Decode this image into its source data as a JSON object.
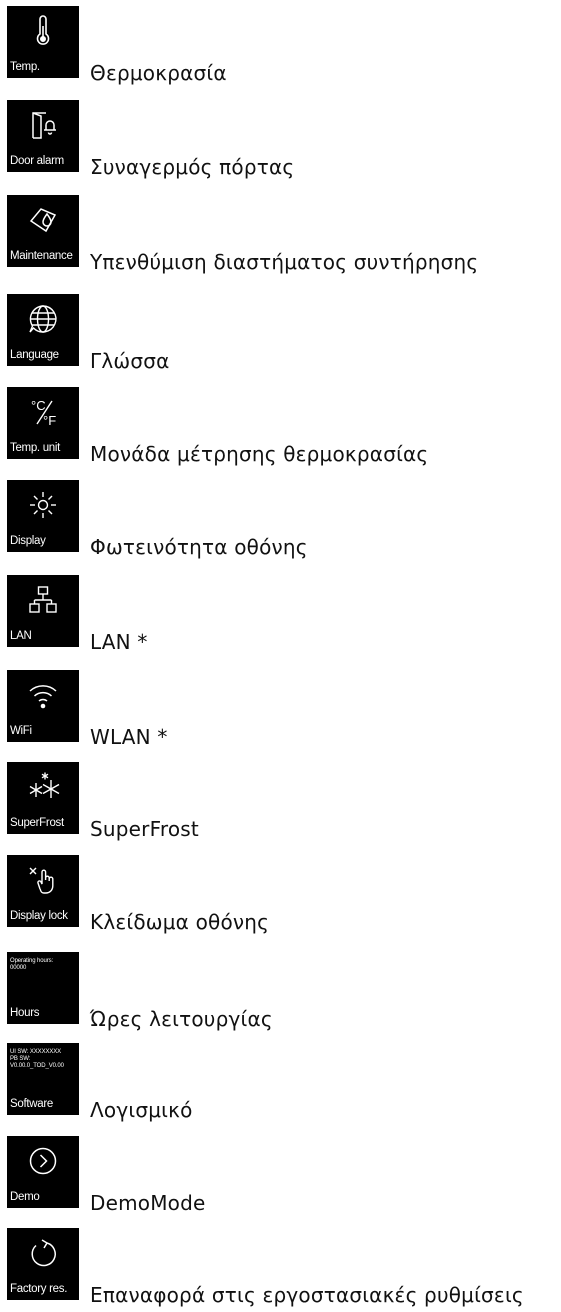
{
  "menu": {
    "items": [
      {
        "caption": "Temp.",
        "label": "Θερμοκρασία",
        "icon": "thermometer-icon"
      },
      {
        "caption": "Door alarm",
        "label": "Συναγερμός πόρτας",
        "icon": "door-alarm-icon"
      },
      {
        "caption": "Maintenance",
        "label": "Υπενθύμιση διαστήματος συντήρησης",
        "icon": "maintenance-icon"
      },
      {
        "caption": "Language",
        "label": "Γλώσσα",
        "icon": "globe-icon"
      },
      {
        "caption": "Temp. unit",
        "label": "Μονάδα μέτρησης θερμοκρασίας",
        "icon": "celsius-fahrenheit-icon",
        "glyph_c": "°C",
        "glyph_f": "°F"
      },
      {
        "caption": "Display",
        "label": "Φωτεινότητα οθόνης",
        "icon": "brightness-icon"
      },
      {
        "caption": "LAN",
        "label": "LAN *",
        "icon": "network-icon"
      },
      {
        "caption": "WiFi",
        "label": "WLAN *",
        "icon": "wifi-icon"
      },
      {
        "caption": "SuperFrost",
        "label": "SuperFrost",
        "icon": "superfrost-icon"
      },
      {
        "caption": "Display lock",
        "label": "Κλείδωμα οθόνης",
        "icon": "display-lock-icon"
      },
      {
        "caption": "Hours",
        "label": "Ώρες λειτουργίας",
        "icon": "hours-text",
        "detail": "Operating hours:\n00000"
      },
      {
        "caption": "Software",
        "label": "Λογισμικό",
        "icon": "software-text",
        "detail": "UI SW: XXXXXXXX\nPB SW:\nV0.00.0_TOD_V0.00"
      },
      {
        "caption": "Demo",
        "label": "DemoMode",
        "icon": "play-circle-icon"
      },
      {
        "caption": "Factory res.",
        "label": "Επαναφορά στις εργοστασιακές ρυθμίσεις",
        "icon": "factory-reset-icon"
      }
    ]
  }
}
